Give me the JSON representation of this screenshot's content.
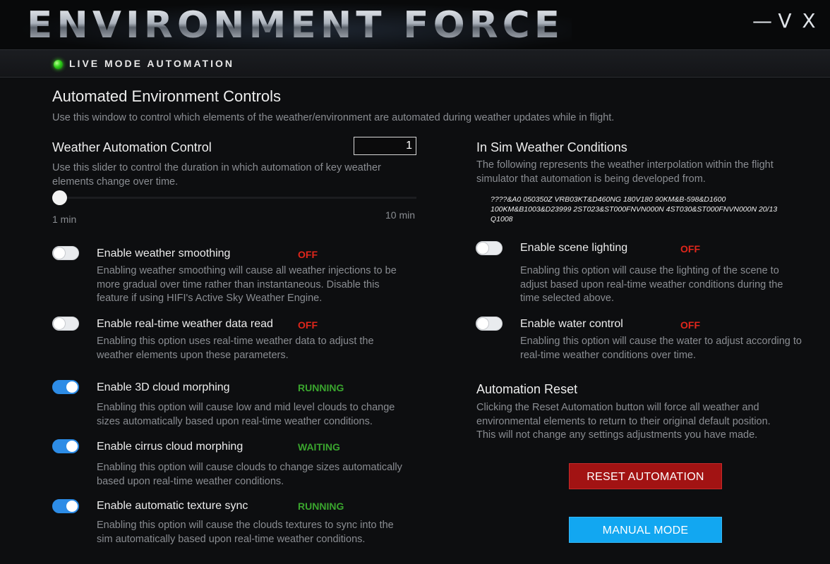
{
  "header": {
    "title": "ENVIRONMENT FORCE",
    "window_controls": [
      {
        "glyph": "—",
        "icon": "minimize-icon"
      },
      {
        "glyph": "V",
        "icon": "collapse-icon"
      },
      {
        "glyph": "X",
        "icon": "close-icon"
      }
    ]
  },
  "live_mode": {
    "label": "LIVE MODE AUTOMATION",
    "indicator_color": "#2fcf1a"
  },
  "page": {
    "title": "Automated Environment Controls",
    "description": "Use this window to control which elements of the weather/environment are automated during weather updates while in flight."
  },
  "weather_automation": {
    "title": "Weather Automation Control",
    "value": "1",
    "description": "Use this slider to control the duration in which automation of key weather elements change over time.",
    "slider": {
      "min_label": "1 min",
      "max_label": "10 min",
      "min": 1,
      "max": 10,
      "value": 1
    }
  },
  "sim_conditions": {
    "title": "In Sim Weather Conditions",
    "description": "The following represents the weather interpolation within the flight simulator that automation is being developed from.",
    "metar": "????&A0 050350Z VRB03KT&D460NG 180V180 90KM&B-598&D1600 100KM&B1003&D23999 2ST023&ST000FNVN000N 4ST030&ST000FNVN000N 20/13 Q1008"
  },
  "options_left": [
    {
      "label": "Enable weather smoothing",
      "status": "OFF",
      "status_color": "#e0261b",
      "enabled": false,
      "description": "Enabling weather smoothing will cause all weather injections to be more gradual over time rather than instantaneous.  Disable this feature if using HIFI's Active Sky Weather Engine."
    },
    {
      "label": "Enable real-time weather data read",
      "status": "OFF",
      "status_color": "#e0261b",
      "enabled": false,
      "description": "Enabling this option uses real-time weather data to adjust the weather elements upon these parameters."
    },
    {
      "label": "Enable 3D cloud morphing",
      "status": "RUNNING",
      "status_color": "#3aa52e",
      "enabled": true,
      "description": "Enabling this option will cause low and mid level clouds to change sizes automatically based upon real-time weather conditions."
    },
    {
      "label": "Enable cirrus cloud morphing",
      "status": "WAITING",
      "status_color": "#3aa52e",
      "enabled": true,
      "description": "Enabling this option will cause clouds to change sizes automatically based upon real-time weather conditions."
    },
    {
      "label": "Enable automatic texture sync",
      "status": "RUNNING",
      "status_color": "#3aa52e",
      "enabled": true,
      "description": "Enabling this option will cause the clouds textures to sync into the sim automatically based upon real-time weather conditions."
    }
  ],
  "options_right": [
    {
      "label": "Enable scene lighting",
      "status": "OFF",
      "status_color": "#e0261b",
      "enabled": false,
      "description": "Enabling this option will cause the lighting of the scene to adjust based upon real-time weather conditions during the time selected above."
    },
    {
      "label": "Enable water control",
      "status": "OFF",
      "status_color": "#e0261b",
      "enabled": false,
      "description": "Enabling this option will cause the water to adjust according to real-time weather conditions over time."
    }
  ],
  "reset": {
    "title": "Automation Reset",
    "description": "Clicking the Reset Automation button will force all weather and environmental elements to return to their original default position. This will not change any settings adjustments you have made.",
    "reset_button": "RESET AUTOMATION",
    "manual_button": "MANUAL MODE"
  }
}
